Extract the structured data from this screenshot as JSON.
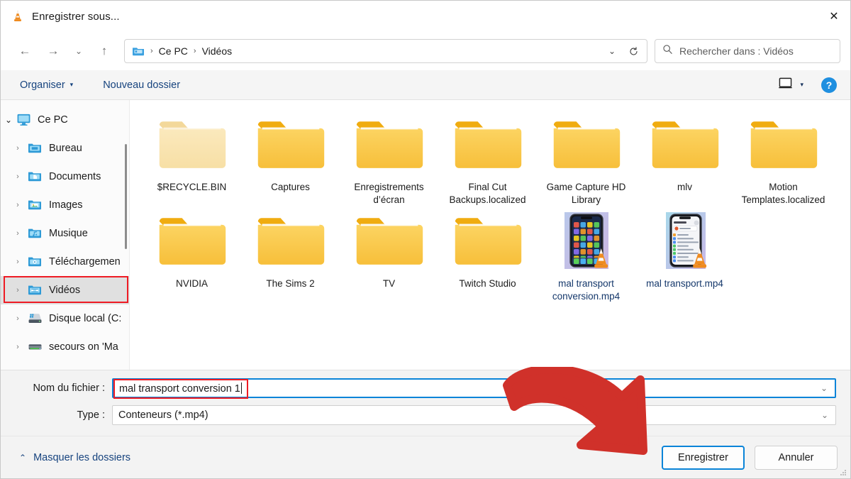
{
  "window": {
    "title": "Enregistrer sous...",
    "app_icon": "vlc-cone-icon",
    "close_label": "✕"
  },
  "nav": {
    "back": "←",
    "forward": "→",
    "recent": "⌄",
    "up": "↑",
    "breadcrumbs": [
      "Ce PC",
      "Vidéos"
    ],
    "separator": "›",
    "dropdown": "⌄",
    "refresh": "⟳"
  },
  "search": {
    "placeholder": "Rechercher dans : Vidéos",
    "icon": "search-icon"
  },
  "toolbar": {
    "organise": "Organiser",
    "organise_caret": "▾",
    "new_folder": "Nouveau dossier",
    "view_caret": "▾",
    "help": "?"
  },
  "sidebar": {
    "items": [
      {
        "label": "Ce PC",
        "icon": "monitor-icon",
        "level": 0,
        "expanded": true,
        "chevron": "⌄",
        "selected": false
      },
      {
        "label": "Bureau",
        "icon": "folder-desktop-icon",
        "level": 1,
        "expanded": false,
        "chevron": "›",
        "selected": false
      },
      {
        "label": "Documents",
        "icon": "folder-documents-icon",
        "level": 1,
        "expanded": false,
        "chevron": "›",
        "selected": false
      },
      {
        "label": "Images",
        "icon": "folder-pictures-icon",
        "level": 1,
        "expanded": false,
        "chevron": "›",
        "selected": false
      },
      {
        "label": "Musique",
        "icon": "folder-music-icon",
        "level": 1,
        "expanded": false,
        "chevron": "›",
        "selected": false
      },
      {
        "label": "Téléchargemen",
        "icon": "folder-downloads-icon",
        "level": 1,
        "expanded": false,
        "chevron": "›",
        "selected": false
      },
      {
        "label": "Vidéos",
        "icon": "folder-videos-icon",
        "level": 1,
        "expanded": false,
        "chevron": "›",
        "selected": true
      },
      {
        "label": "Disque local (C:",
        "icon": "drive-icon",
        "level": 1,
        "expanded": false,
        "chevron": "›",
        "selected": false
      },
      {
        "label": "secours on 'Ma",
        "icon": "network-drive-icon",
        "level": 1,
        "expanded": false,
        "chevron": "›",
        "selected": false
      }
    ]
  },
  "files": [
    {
      "name": "$RECYCLE.BIN",
      "type": "folder",
      "faded": true
    },
    {
      "name": "Captures",
      "type": "folder",
      "faded": false
    },
    {
      "name": "Enregistrements d’écran",
      "type": "folder",
      "faded": false
    },
    {
      "name": "Final Cut Backups.localized",
      "type": "folder",
      "faded": false
    },
    {
      "name": "Game Capture HD Library",
      "type": "folder",
      "faded": false
    },
    {
      "name": "mlv",
      "type": "folder",
      "faded": false
    },
    {
      "name": "Motion Templates.localized",
      "type": "folder",
      "faded": false
    },
    {
      "name": "NVIDIA",
      "type": "folder",
      "faded": false
    },
    {
      "name": "The Sims 2",
      "type": "folder",
      "faded": false
    },
    {
      "name": "TV",
      "type": "folder",
      "faded": false
    },
    {
      "name": "Twitch Studio",
      "type": "folder",
      "faded": false
    },
    {
      "name": "mal transport conversion.mp4",
      "type": "video-home",
      "faded": false
    },
    {
      "name": "mal transport.mp4",
      "type": "video-list",
      "faded": false
    }
  ],
  "fields": {
    "filename_label": "Nom du fichier :",
    "filename_value": "mal transport conversion 1",
    "filetype_label": "Type :",
    "filetype_value": "Conteneurs (*.mp4)",
    "combo_arrow": "⌄"
  },
  "footer": {
    "hide_folders": "Masquer les dossiers",
    "hide_folders_caret": "⌃",
    "save": "Enregistrer",
    "cancel": "Annuler"
  },
  "annotations": {
    "arrow_color": "#d0312a",
    "highlight_color": "#ee1b24"
  }
}
